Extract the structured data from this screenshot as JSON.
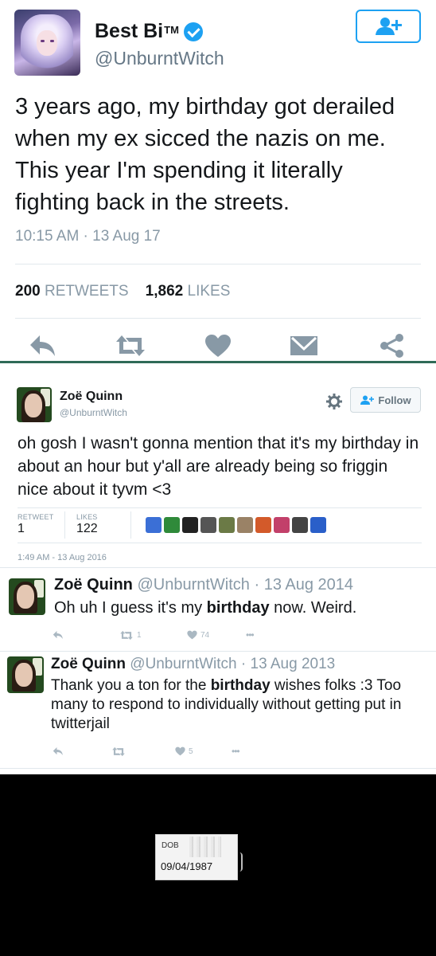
{
  "tweet_main": {
    "display_name": "Best Bi",
    "trademark": "TM",
    "handle": "@UnburntWitch",
    "text": "3 years ago, my birthday got derailed when my ex sicced the nazis on me. This year I'm spending it literally fighting back in the streets.",
    "timestamp": "10:15 AM · 13 Aug 17",
    "retweets_count": "200",
    "retweets_label": "RETWEETS",
    "likes_count": "1,862",
    "likes_label": "LIKES",
    "colors": {
      "accent": "#1da1f2",
      "icon_gray": "#8899a6",
      "divider_green": "#2f6a57"
    }
  },
  "tweet_second": {
    "display_name": "Zoë Quinn",
    "handle": "@UnburntWitch",
    "follow_label": "Follow",
    "text": "oh gosh I wasn't gonna mention that it's my birthday in about an hour but y'all are already being so friggin nice about it tyvm <3",
    "retweet_label": "RETWEET",
    "retweet_count": "1",
    "likes_label": "LIKES",
    "likes_count": "122",
    "timestamp": "1:49 AM - 13 Aug 2016",
    "liker_colors": [
      "#3b6fd6",
      "#2f8a3a",
      "#222222",
      "#555555",
      "#6b7a46",
      "#9a8266",
      "#d35a2a",
      "#c2406a",
      "#444444",
      "#2a5fc9"
    ]
  },
  "tweet_2014": {
    "display_name": "Zoë Quinn",
    "handle": "@UnburntWitch",
    "date": "· 13 Aug 2014",
    "text_before": "Oh uh I guess it's my ",
    "text_bold": "birthday",
    "text_after": " now. Weird.",
    "retweet_count": "1",
    "like_count": "74",
    "more": "•••"
  },
  "tweet_2013": {
    "display_name": "Zoë Quinn",
    "handle": "@UnburntWitch",
    "date": "· 13 Aug 2013",
    "text_before": "Thank you a ton for the ",
    "text_bold": "birthday",
    "text_after": " wishes folks :3 Too many to respond to individually without getting put in twitterjail",
    "like_count": "5",
    "more": "•••"
  },
  "document": {
    "label": "DOB",
    "value": "09/04/1987"
  }
}
